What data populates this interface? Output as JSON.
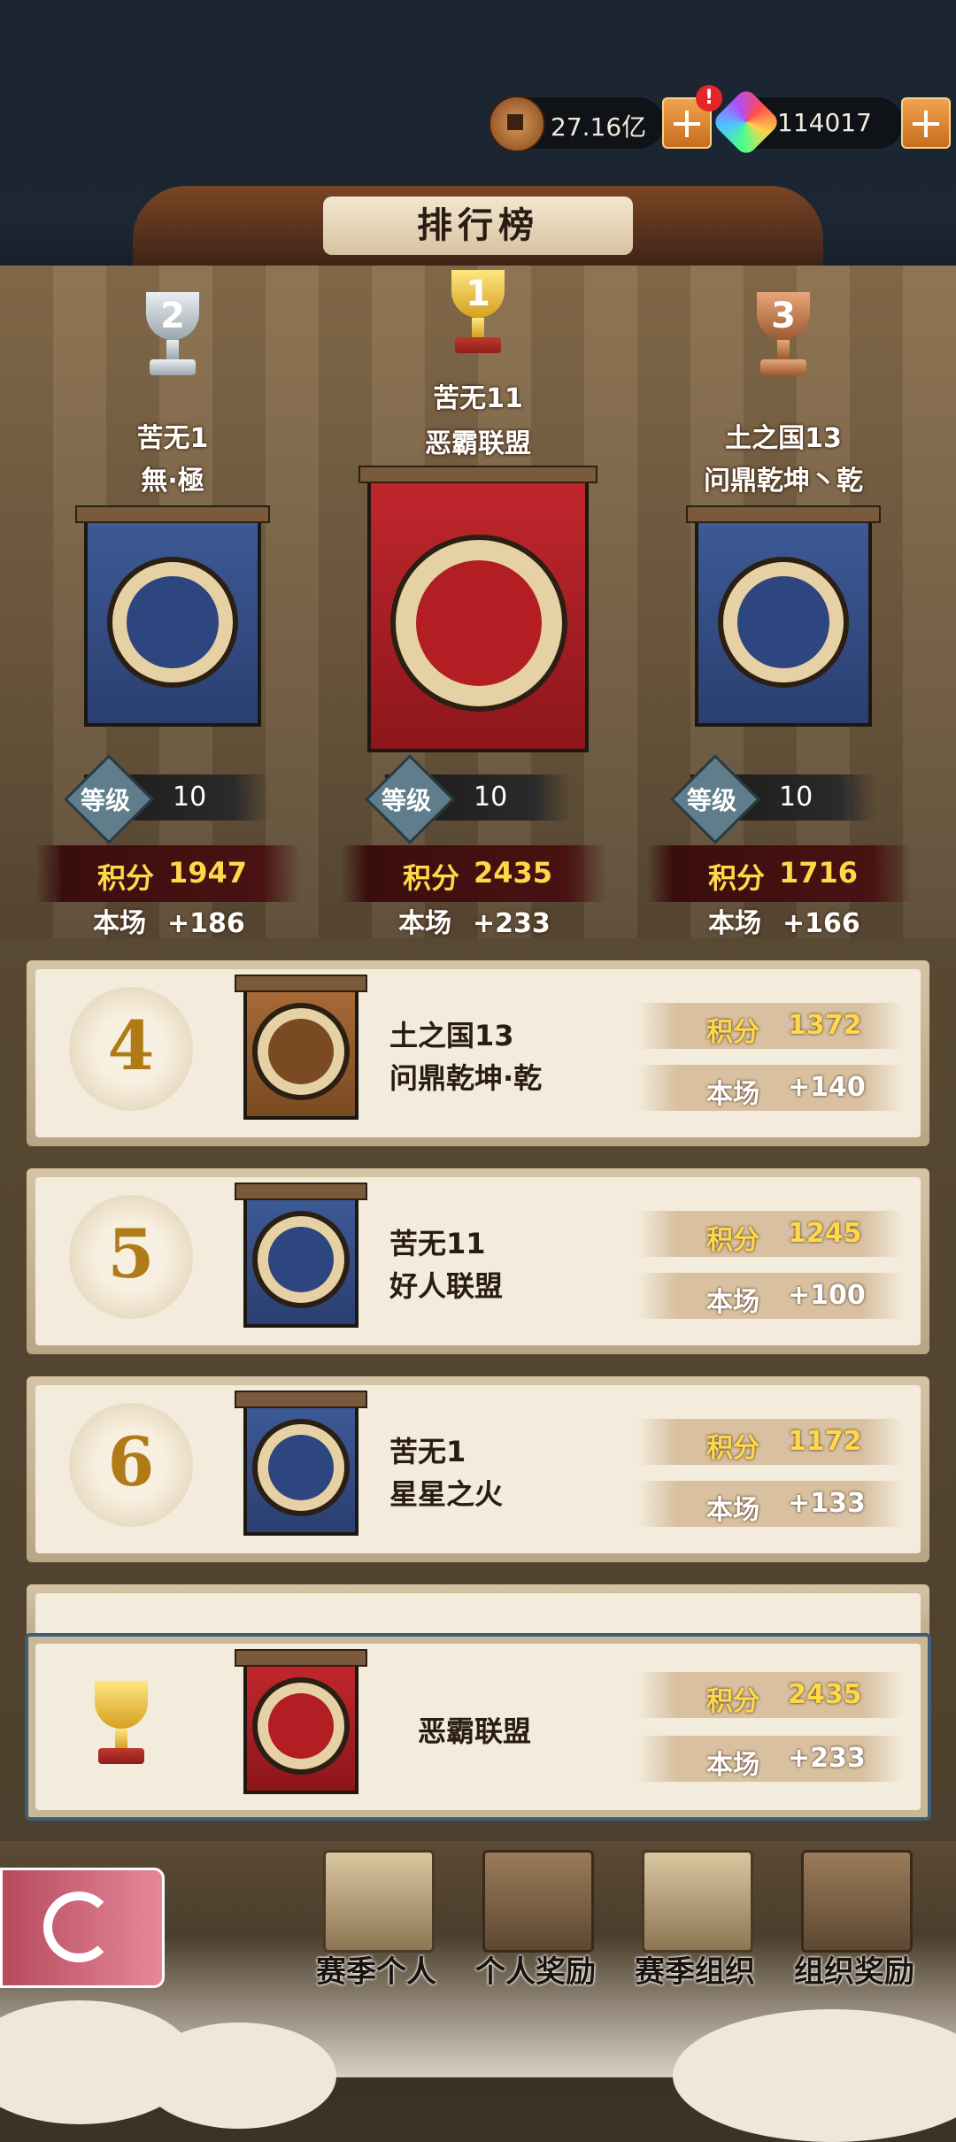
{
  "currency": {
    "coins": "27.16亿",
    "gems": "114017",
    "plus": "+",
    "alert": "!"
  },
  "title": "排行榜",
  "podium": [
    {
      "rank": "2",
      "server": "苦无1",
      "guild": "無·極",
      "level_label": "等级",
      "level": "10",
      "score_label": "积分",
      "score": "1947",
      "gain_label": "本场",
      "gain": "+186",
      "color": "#2e4680"
    },
    {
      "rank": "1",
      "server": "苦无11",
      "guild": "恶霸联盟",
      "level_label": "等级",
      "level": "10",
      "score_label": "积分",
      "score": "2435",
      "gain_label": "本场",
      "gain": "+233",
      "color": "#b21e24"
    },
    {
      "rank": "3",
      "server": "土之国13",
      "guild": "问鼎乾坤丶乾",
      "level_label": "等级",
      "level": "10",
      "score_label": "积分",
      "score": "1716",
      "gain_label": "本场",
      "gain": "+166",
      "color": "#2e4680"
    }
  ],
  "list": [
    {
      "rank": "4",
      "server": "土之国13",
      "guild": "问鼎乾坤·乾",
      "score_label": "积分",
      "score": "1372",
      "gain_label": "本场",
      "gain": "+140"
    },
    {
      "rank": "5",
      "server": "苦无11",
      "guild": "好人联盟",
      "score_label": "积分",
      "score": "1245",
      "gain_label": "本场",
      "gain": "+100"
    },
    {
      "rank": "6",
      "server": "苦无1",
      "guild": "星星之火",
      "score_label": "积分",
      "score": "1172",
      "gain_label": "本场",
      "gain": "+133"
    }
  ],
  "mine": {
    "guild": "恶霸联盟",
    "score_label": "积分",
    "score": "2435",
    "gain_label": "本场",
    "gain": "+233"
  },
  "menu": [
    "赛季个人",
    "个人奖励",
    "赛季组织",
    "组织奖励"
  ]
}
